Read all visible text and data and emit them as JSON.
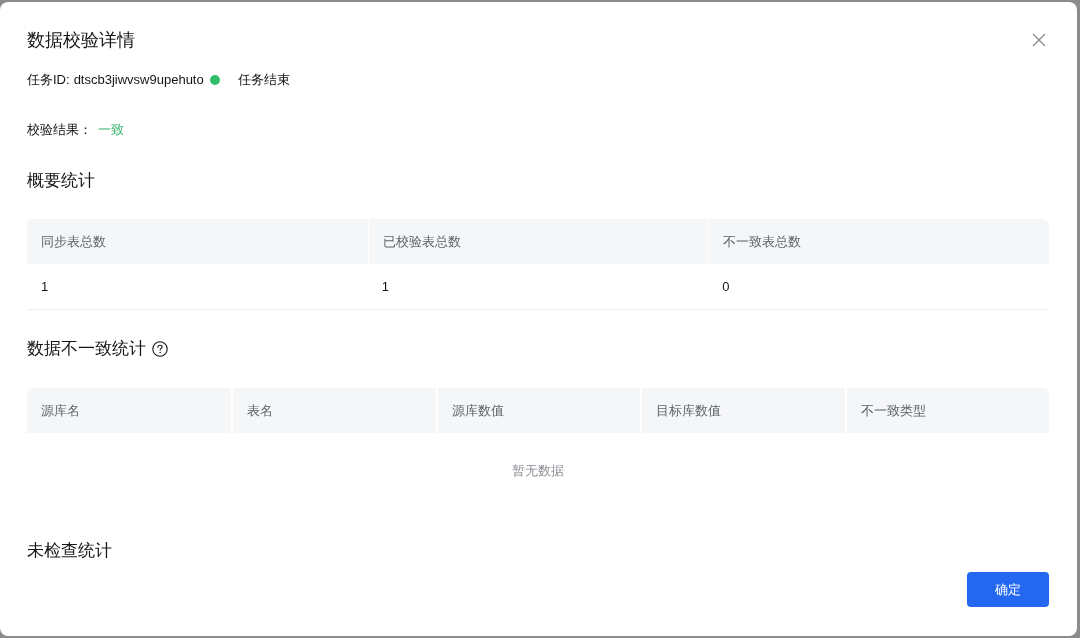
{
  "dialog": {
    "title": "数据校验详情"
  },
  "task": {
    "label": "任务ID:",
    "id": "dtscb3jiwvsw9upehuto",
    "status": {
      "kind": "success",
      "text": "任务结束"
    }
  },
  "result": {
    "label": "校验结果：",
    "value": "一致",
    "kind": "success"
  },
  "summary": {
    "heading": "概要统计",
    "columns": [
      "同步表总数",
      "已校验表总数",
      "不一致表总数"
    ],
    "rows": [
      [
        "1",
        "1",
        "0"
      ]
    ]
  },
  "mismatch": {
    "heading": "数据不一致统计",
    "help": true,
    "columns": [
      "源库名",
      "表名",
      "源库数值",
      "目标库数值",
      "不一致类型"
    ],
    "empty_text": "暂无数据"
  },
  "unchecked": {
    "heading": "未检查统计"
  },
  "footer": {
    "confirm": "确定"
  }
}
